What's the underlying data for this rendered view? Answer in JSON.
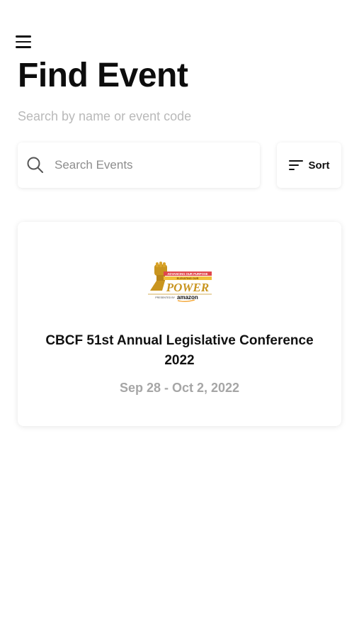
{
  "header": {
    "menu_icon": "hamburger-menu-icon",
    "title": "Find Event",
    "subtitle": "Search by name or event code"
  },
  "search": {
    "placeholder": "Search Events",
    "value": "",
    "icon": "search-icon"
  },
  "sort": {
    "label": "Sort",
    "icon": "sort-lines-icon"
  },
  "events": [
    {
      "name": "CBCF 51st Annual Legislative Conference 2022",
      "dates": "Sep 28 - Oct 2, 2022",
      "logo": {
        "line1": "ADVANCING OUR PURPOSE",
        "line2": "ELEVATING OUR",
        "word": "POWER",
        "presented": "PRESENTED BY",
        "sponsor": "amazon"
      }
    }
  ],
  "colors": {
    "title": "#0d0d0d",
    "subtitle": "#b9b9b9",
    "placeholder": "#8d8d8d",
    "date": "#a6a6a6",
    "logo_gold": "#c9951f",
    "logo_red": "#e0474c"
  }
}
